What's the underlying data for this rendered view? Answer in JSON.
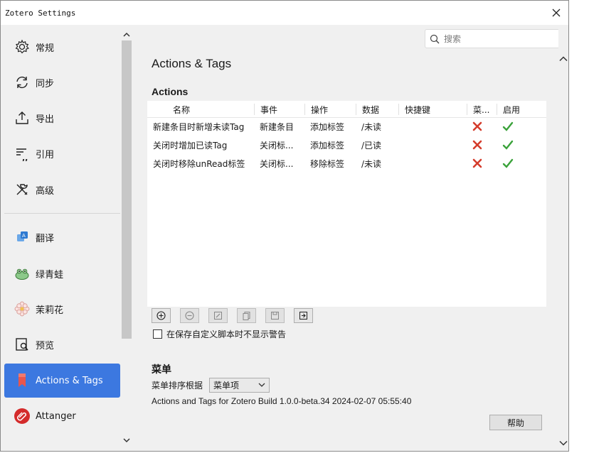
{
  "window": {
    "title": "Zotero Settings"
  },
  "search": {
    "placeholder": "搜索"
  },
  "sidebar": {
    "items": [
      {
        "label": "常规",
        "icon": "gear-icon"
      },
      {
        "label": "同步",
        "icon": "sync-icon"
      },
      {
        "label": "导出",
        "icon": "export-icon"
      },
      {
        "label": "引用",
        "icon": "cite-icon"
      },
      {
        "label": "高级",
        "icon": "tools-icon"
      },
      {
        "label": "翻译",
        "icon": "translate-icon"
      },
      {
        "label": "绿青蛙",
        "icon": "frog-icon"
      },
      {
        "label": "茉莉花",
        "icon": "flower-icon"
      },
      {
        "label": "预览",
        "icon": "preview-icon"
      },
      {
        "label": "Actions & Tags",
        "icon": "bookmark-icon",
        "selected": true
      },
      {
        "label": "Attanger",
        "icon": "paperclip-icon"
      }
    ]
  },
  "pane": {
    "title": "Actions & Tags",
    "actions_heading": "Actions",
    "table": {
      "columns": [
        "名称",
        "事件",
        "操作",
        "数据",
        "快捷键",
        "菜...",
        "启用"
      ],
      "rows": [
        {
          "name": "新建条目时新增未读Tag",
          "event": "新建条目",
          "operation": "添加标签",
          "data": "/未读",
          "shortcut": "",
          "menu": false,
          "enabled": true
        },
        {
          "name": "关闭时增加已读Tag",
          "event": "关闭标...",
          "operation": "添加标签",
          "data": "/已读",
          "shortcut": "",
          "menu": false,
          "enabled": true
        },
        {
          "name": "关闭时移除unRead标签",
          "event": "关闭标...",
          "operation": "移除标签",
          "data": "/未读",
          "shortcut": "",
          "menu": false,
          "enabled": true
        }
      ]
    },
    "toolbar": [
      "add-icon",
      "remove-icon",
      "edit-icon",
      "copy-icon",
      "save-icon",
      "import-icon"
    ],
    "checkbox_label": "在保存自定义脚本时不显示警告",
    "checkbox_checked": false,
    "menu_heading": "菜单",
    "menu_sort_label": "菜单排序根据",
    "menu_sort_value": "菜单项",
    "info": "Actions and Tags for Zotero Build 1.0.0-beta.34 2024-02-07 05:55:40",
    "help_label": "帮助"
  },
  "colors": {
    "accent": "#3c78e0",
    "cross": "#d43c2c",
    "check": "#3aa23a"
  }
}
